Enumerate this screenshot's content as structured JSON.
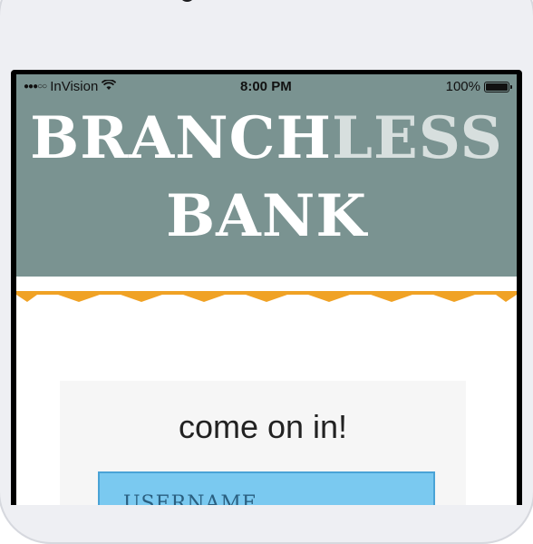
{
  "status_bar": {
    "carrier": "InVision",
    "signal": "●●●○○",
    "time": "8:00 PM",
    "battery": "100%"
  },
  "brand": {
    "part1": "BRANCH",
    "part2": "LESS",
    "part3": "BANK"
  },
  "login": {
    "greeting": "come on in!",
    "username_placeholder": "USERNAME"
  },
  "colors": {
    "header_bg": "#7a9391",
    "accent_zigzag": "#f0a225",
    "field_bg": "#7ac9f0"
  }
}
